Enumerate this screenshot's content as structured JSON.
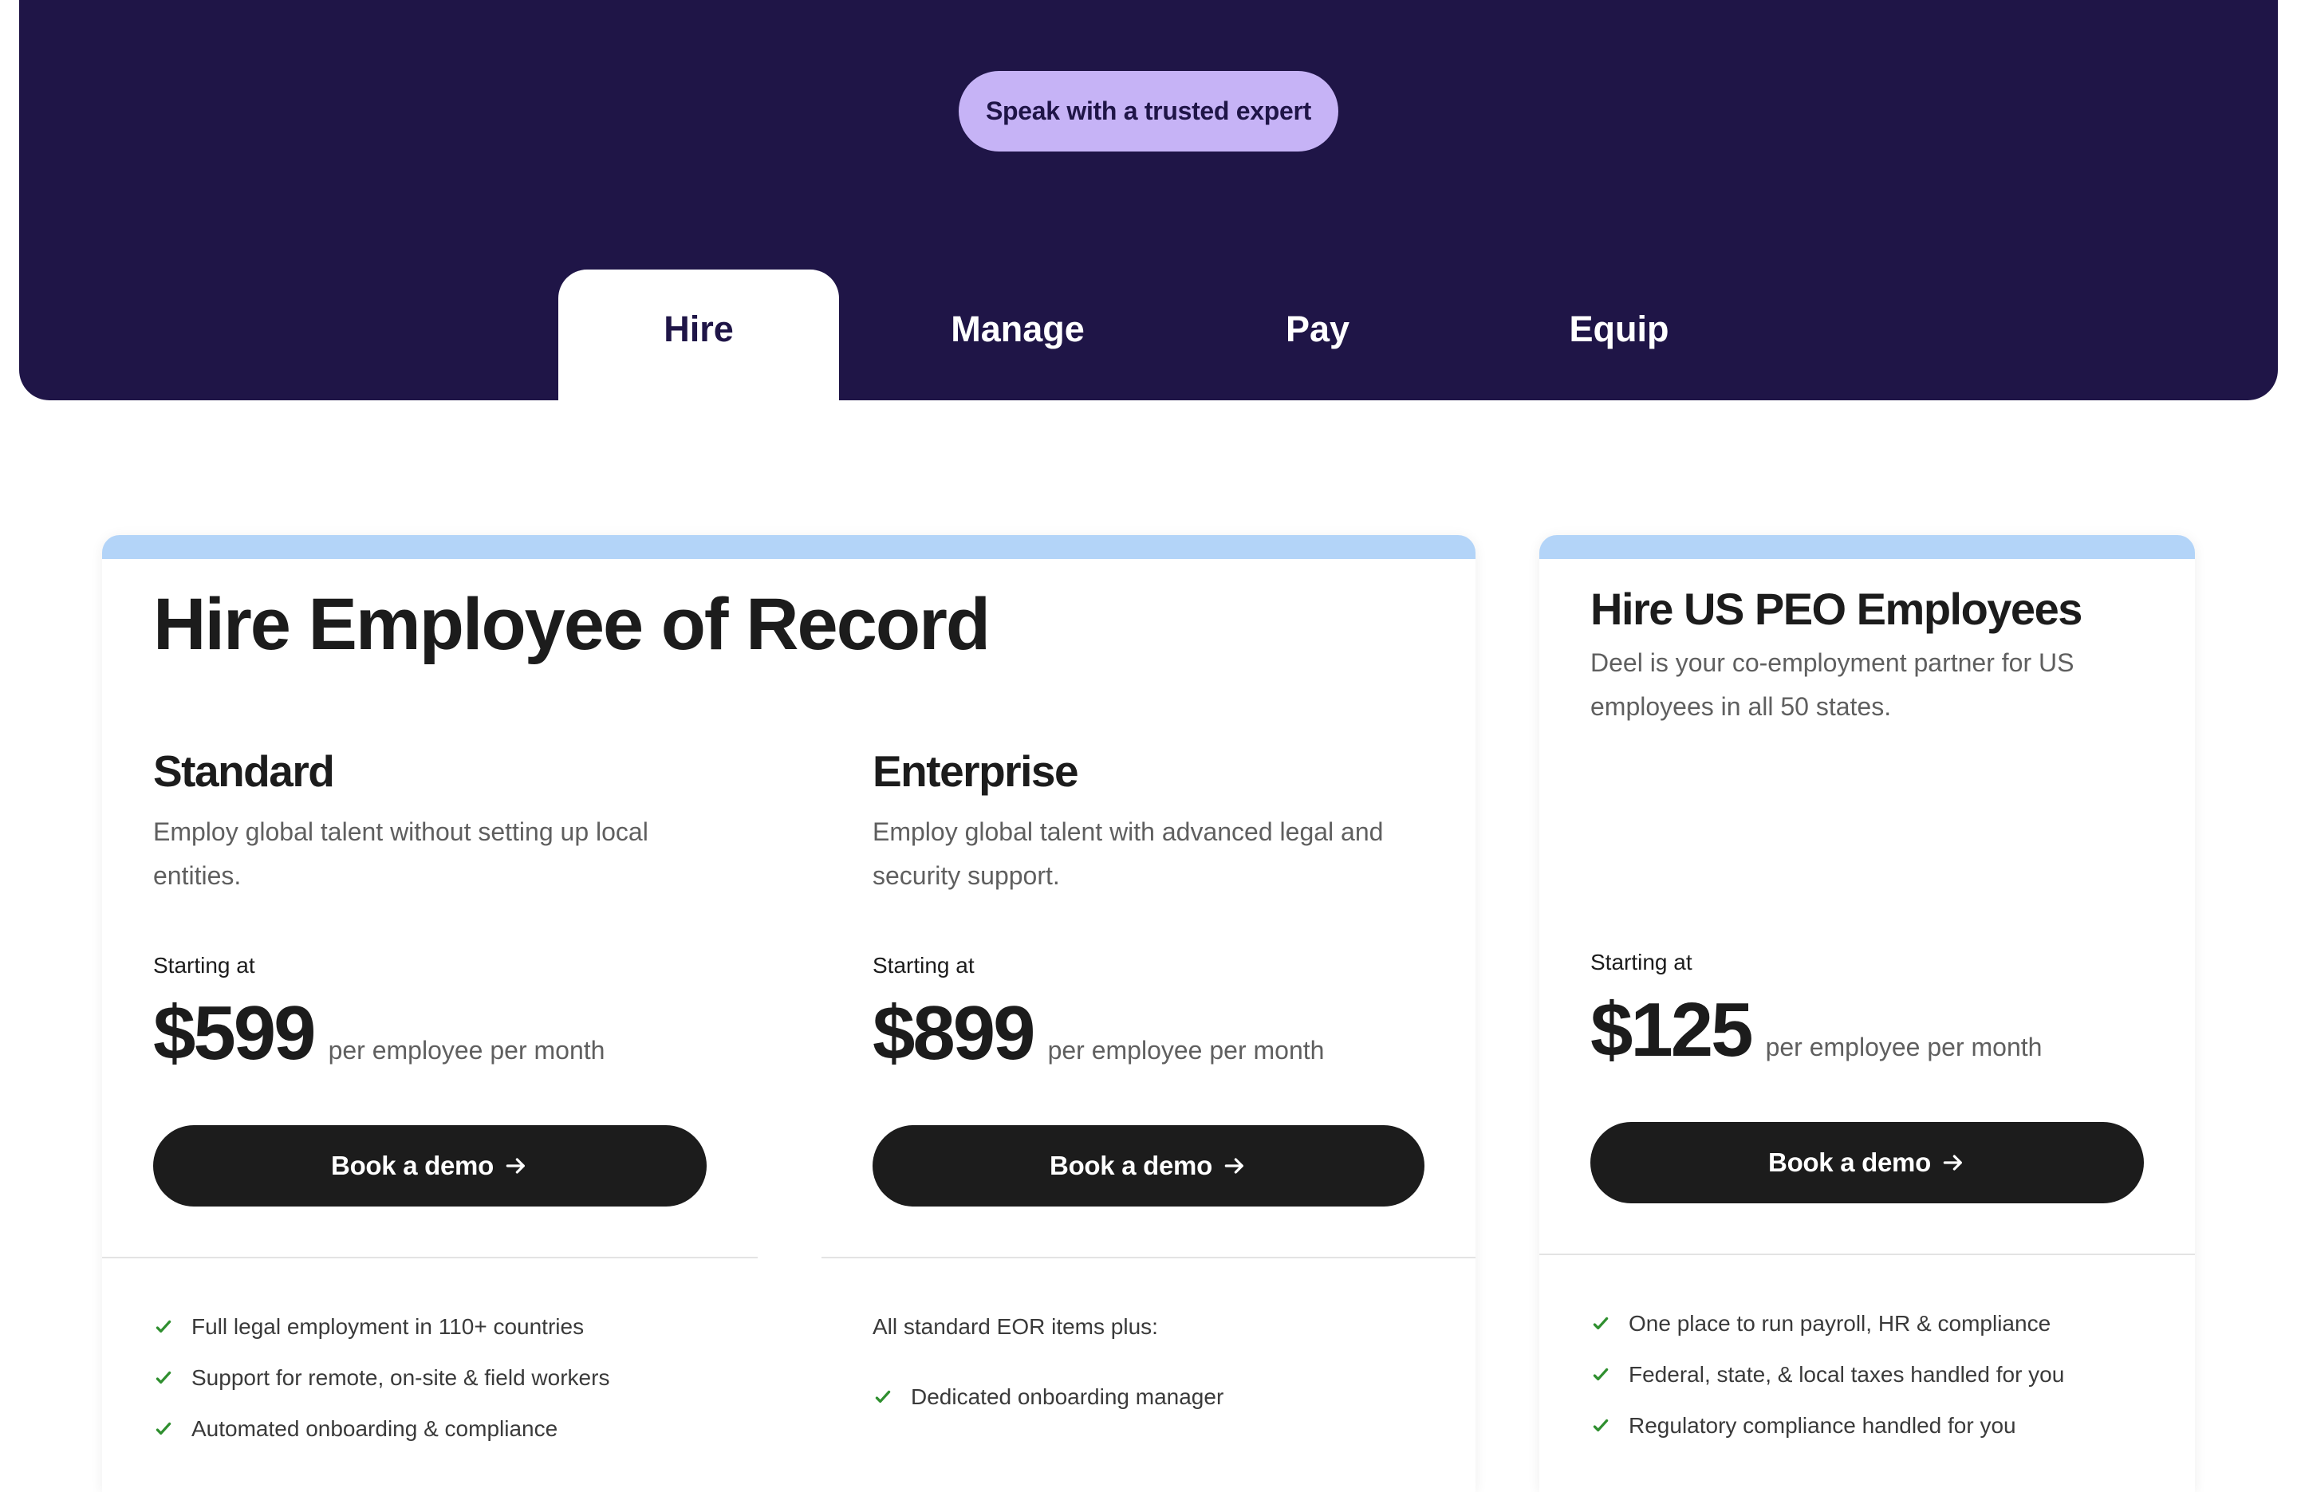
{
  "hero": {
    "expert_button": "Speak with a trusted expert",
    "tabs": [
      {
        "label": "Hire",
        "active": true
      },
      {
        "label": "Manage",
        "active": false
      },
      {
        "label": "Pay",
        "active": false
      },
      {
        "label": "Equip",
        "active": false
      }
    ]
  },
  "colors": {
    "hero_background": "#1f1547",
    "expert_button": "#c6b3f6",
    "card_top_bar": "#b3d4f8",
    "button": "#1c1c1c",
    "check": "#2f8f2f"
  },
  "eor_card": {
    "title": "Hire Employee of Record",
    "plans": [
      {
        "name": "Standard",
        "description": "Employ global talent without setting up local entities.",
        "starting_label": "Starting at",
        "price": "$599",
        "per": "per employee per month",
        "button": "Book a demo",
        "note": "",
        "features": [
          "Full legal employment in 110+ countries",
          "Support for remote, on-site & field workers",
          "Automated onboarding & compliance"
        ]
      },
      {
        "name": "Enterprise",
        "description": "Employ global talent with advanced legal and security support.",
        "starting_label": "Starting at",
        "price": "$899",
        "per": "per employee per month",
        "button": "Book a demo",
        "note": "All standard EOR items plus:",
        "features": [
          "Dedicated onboarding manager"
        ]
      }
    ]
  },
  "peo_card": {
    "title": "Hire US PEO Employees",
    "description": "Deel is your co-employment partner for US employees in all 50 states.",
    "starting_label": "Starting at",
    "price": "$125",
    "per": "per employee per month",
    "button": "Book a demo",
    "features": [
      "One place to run payroll, HR & compliance",
      "Federal, state, & local taxes handled for you",
      "Regulatory compliance handled for you"
    ]
  },
  "icons": {
    "arrow": "arrow-right-icon",
    "check": "check-icon"
  }
}
